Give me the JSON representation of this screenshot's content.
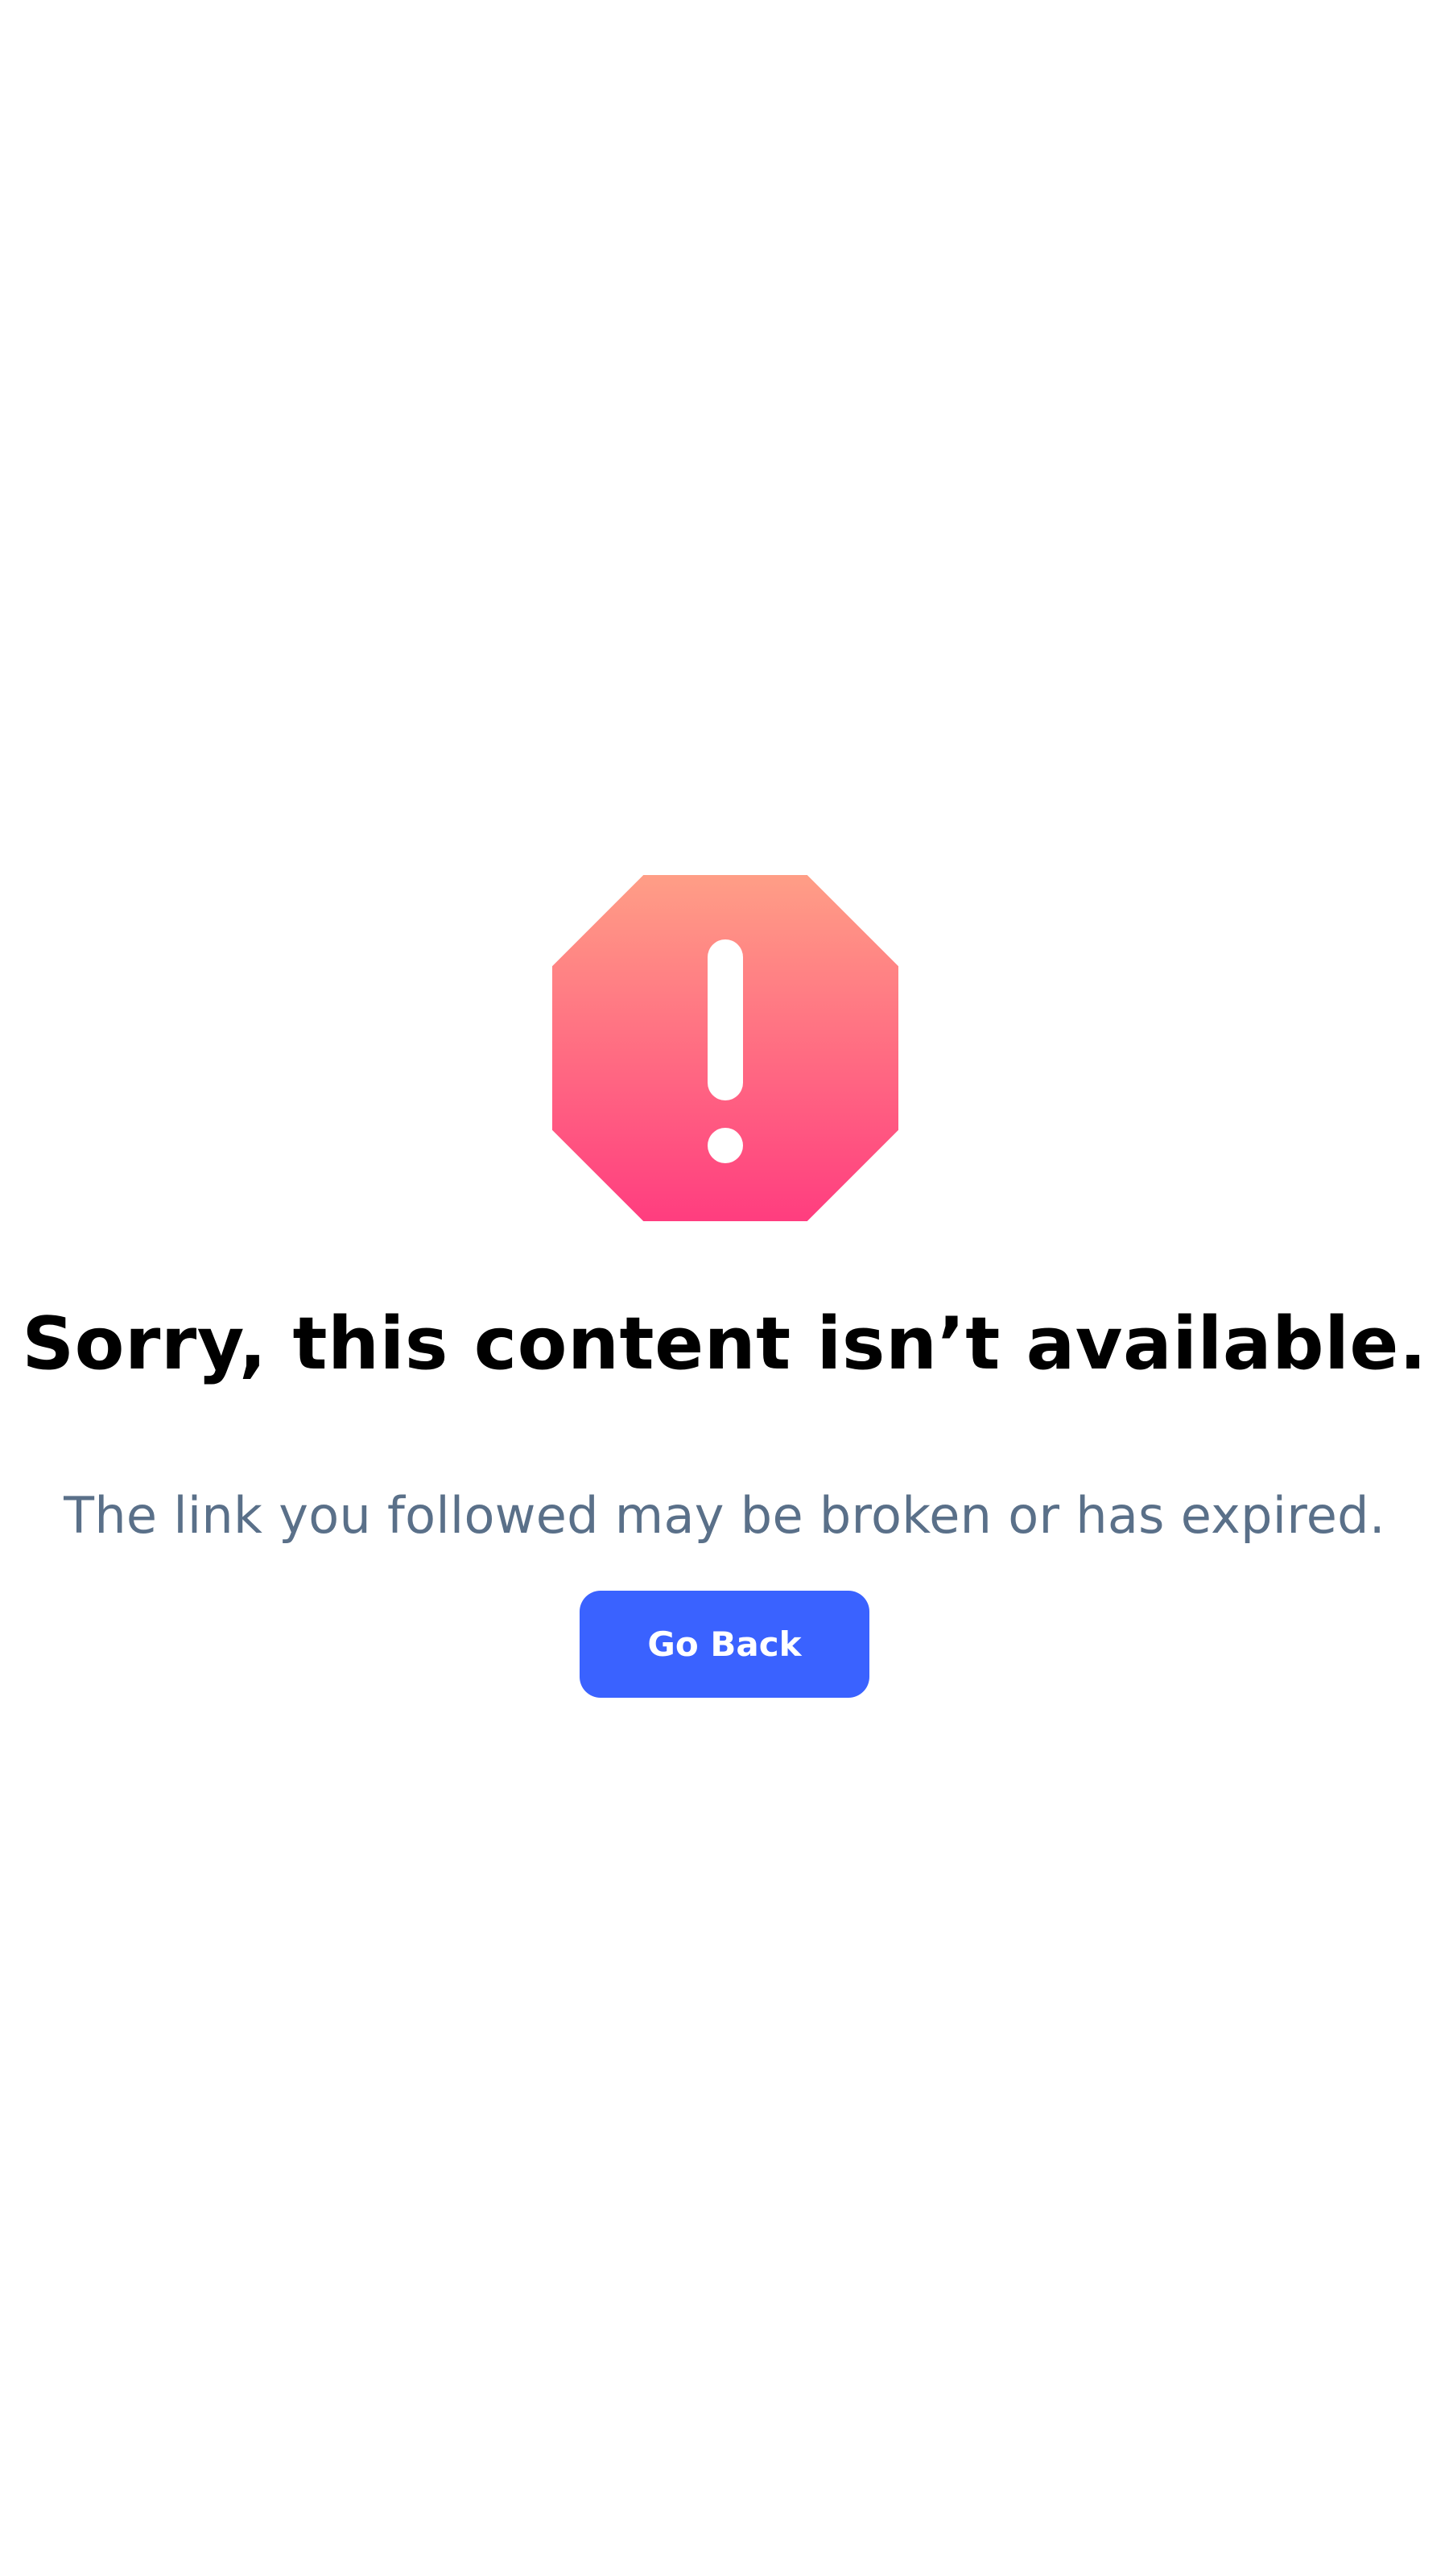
{
  "error": {
    "icon": "exclamation-stop-sign-icon",
    "title": "Sorry, this content isn’t available.",
    "message": "The link you followed may be broken or has expired.",
    "button_label": "Go Back"
  },
  "colors": {
    "icon_gradient_top": "#ff9e86",
    "icon_gradient_bottom": "#ff3d7f",
    "button_background": "#3a62ff",
    "message_text": "#5a7089",
    "title_text": "#000000"
  }
}
